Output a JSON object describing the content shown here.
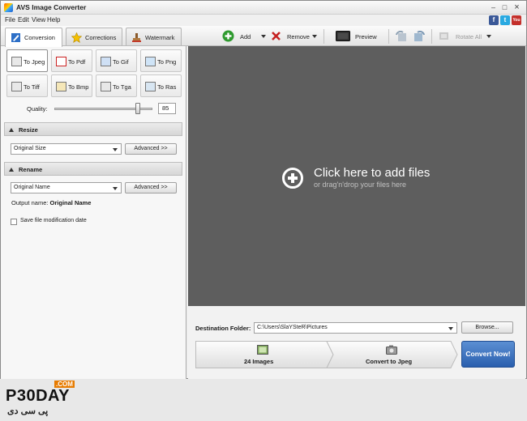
{
  "app": {
    "title": "AVS Image Converter"
  },
  "window_controls": {
    "minimize": "–",
    "maximize": "□",
    "close": "×"
  },
  "menu": [
    "File",
    "Edit",
    "View",
    "Help"
  ],
  "social": {
    "facebook": "f",
    "twitter": "t",
    "youtube": "You"
  },
  "tabs": [
    {
      "label": "Conversion",
      "icon": "pen-icon",
      "active": true
    },
    {
      "label": "Corrections",
      "icon": "star-icon",
      "active": false
    },
    {
      "label": "Watermark",
      "icon": "stamp-icon",
      "active": false
    }
  ],
  "toolbar": {
    "add_label": "Add",
    "remove_label": "Remove",
    "preview_label": "Preview",
    "rotate_all_label": "Rotate All"
  },
  "formats": [
    {
      "label": "To Jpeg",
      "selected": true
    },
    {
      "label": "To Pdf",
      "selected": false
    },
    {
      "label": "To Gif",
      "selected": false
    },
    {
      "label": "To Png",
      "selected": false
    },
    {
      "label": "To Tiff",
      "selected": false
    },
    {
      "label": "To Bmp",
      "selected": false
    },
    {
      "label": "To Tga",
      "selected": false
    },
    {
      "label": "To Ras",
      "selected": false
    }
  ],
  "quality": {
    "label": "Quality:",
    "value": "85",
    "level": 0.85
  },
  "resize": {
    "title": "Resize",
    "option": "Original Size",
    "advanced_label": "Advanced >>"
  },
  "rename": {
    "title": "Rename",
    "option": "Original Name",
    "advanced_label": "Advanced >>",
    "output_label": "Output name:",
    "output_value": "Original Name"
  },
  "save_date": {
    "label": "Save file modification date",
    "checked": false
  },
  "dropzone": {
    "main": "Click here to add files",
    "sub": "or drag'n'drop your files here"
  },
  "destination": {
    "label": "Destination Folder:",
    "path": "C:\\Users\\SlaYSteR\\Pictures",
    "browse_label": "Browse..."
  },
  "steps": {
    "images": "24 Images",
    "convert_to": "Convert to Jpeg"
  },
  "convert_now": "Convert Now!",
  "watermark_logo": {
    "com": ".COM",
    "main": "P30DAY",
    "sub": "پی سی دی"
  }
}
